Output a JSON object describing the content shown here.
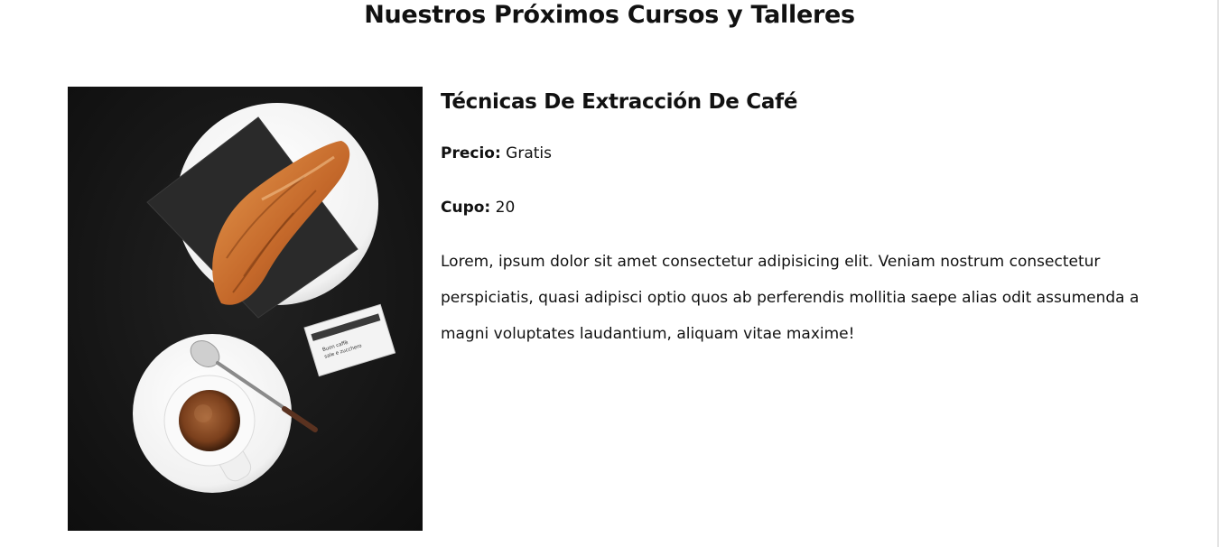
{
  "section": {
    "title": "Nuestros Próximos Cursos y Talleres"
  },
  "course": {
    "title": "Técnicas De Extracción De Café",
    "price_label": "Precio:",
    "price_value": "Gratis",
    "quota_label": "Cupo:",
    "quota_value": "20",
    "description": "Lorem, ipsum dolor sit amet consectetur adipisicing elit. Veniam nostrum consectetur perspiciatis, quasi adipisci optio quos ab perferendis mollitia saepe alias odit assumenda a magni voluptates laudantium, aliquam vitae maxime!",
    "image": {
      "sachet_text_line1": "Buon caffè",
      "sachet_text_line2": "sale e zucchero"
    }
  },
  "colors": {
    "background": "#ffffff",
    "text": "#111111",
    "image_table": "#151515",
    "croissant": "#c87533"
  }
}
